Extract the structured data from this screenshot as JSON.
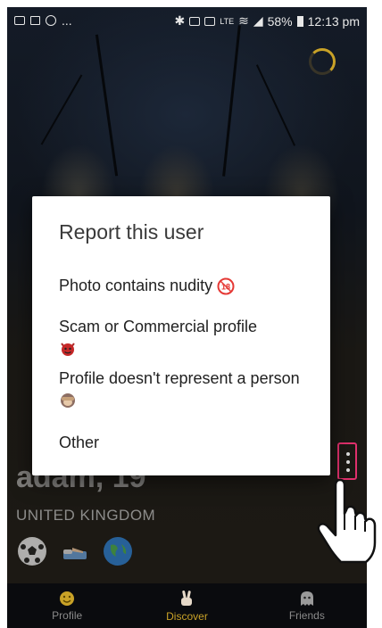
{
  "status_bar": {
    "battery": "58%",
    "time": "12:13 pm",
    "notifications": "..."
  },
  "profile": {
    "name": "adam, 19",
    "country": "UNITED KINGDOM"
  },
  "dialog": {
    "title": "Report this user",
    "options": [
      {
        "label": "Photo contains nudity",
        "icon": "18-plus-icon"
      },
      {
        "label": "Scam or Commercial profile",
        "icon": "devil-icon"
      },
      {
        "label": "Profile doesn't represent a person",
        "icon": "monkey-icon"
      },
      {
        "label": "Other"
      }
    ]
  },
  "nav": {
    "items": [
      {
        "label": "Profile",
        "icon": "smiley-icon"
      },
      {
        "label": "Discover",
        "icon": "peace-hand-icon",
        "active": true
      },
      {
        "label": "Friends",
        "icon": "ghost-icon"
      }
    ]
  },
  "colors": {
    "accent": "#c9a227",
    "highlight": "#e0306c",
    "dialog_bg": "#ffffff"
  }
}
